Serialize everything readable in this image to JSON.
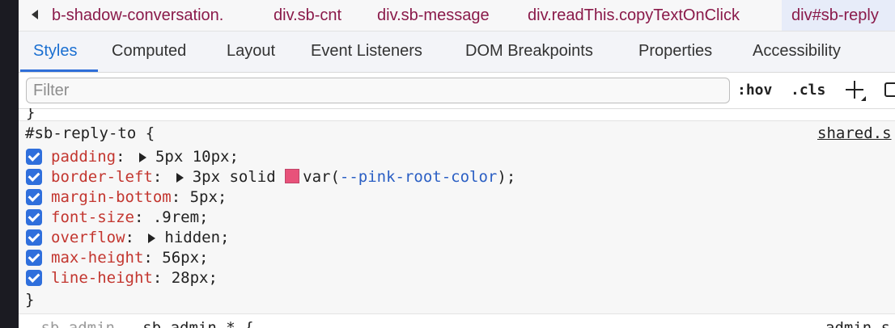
{
  "breadcrumb": {
    "items": [
      "b-shadow-conversation.",
      "div.sb-cnt",
      "div.sb-message",
      "div.readThis.copyTextOnClick",
      "div#sb-reply"
    ]
  },
  "tabs": [
    "Styles",
    "Computed",
    "Layout",
    "Event Listeners",
    "DOM Breakpoints",
    "Properties",
    "Accessibility"
  ],
  "filter": {
    "placeholder": "Filter",
    "value": ""
  },
  "toolbar": {
    "hov": ":hov",
    "cls": ".cls"
  },
  "rule": {
    "selector": "#sb-reply-to {",
    "source": "shared.s",
    "close": "}",
    "declarations": [
      {
        "prop": "padding",
        "value": "5px 10px;",
        "expandable": true
      },
      {
        "prop": "border-left",
        "value_prefix": "3px solid",
        "swatch": "#e8527a",
        "value_fn": "var(",
        "value_var": "--pink-root-color",
        "value_suffix": ");",
        "expandable": true
      },
      {
        "prop": "margin-bottom",
        "value": "5px;"
      },
      {
        "prop": "font-size",
        "value": ".9rem;"
      },
      {
        "prop": "overflow",
        "value": "hidden;",
        "expandable": true
      },
      {
        "prop": "max-height",
        "value": "56px;"
      },
      {
        "prop": "line-height",
        "value": "28px;"
      }
    ]
  },
  "next_rule": {
    "selector_dim": ".sb-admin, ",
    "selector": ".sb-admin * {",
    "source": "admin.s"
  },
  "colors": {
    "accent": "#2f6fdc",
    "property": "#c3362f",
    "variable": "#2b5fc4",
    "crumb": "#8a1a4a",
    "pink_root_color": "#e8527a"
  }
}
